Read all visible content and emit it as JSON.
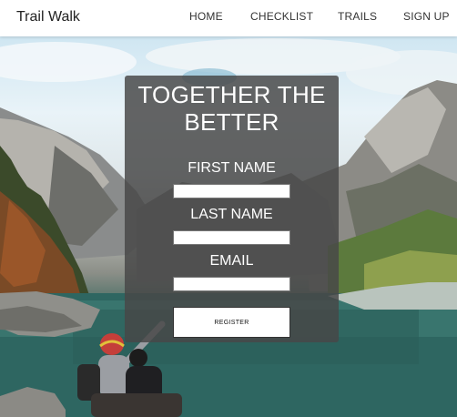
{
  "navbar": {
    "brand": "Trail Walk",
    "links": [
      "HOME",
      "CHECKLIST",
      "TRAILS",
      "SIGN UP"
    ]
  },
  "form": {
    "heading_line1": "TOGETHER THE",
    "heading_line2": "BETTER",
    "first_name_label": "FIRST NAME",
    "first_name_value": "",
    "last_name_label": "LAST NAME",
    "last_name_value": "",
    "email_label": "EMAIL",
    "email_value": "",
    "register_label": "REGISTER"
  },
  "colors": {
    "navbar_bg": "#ffffff",
    "card_bg": "#484848",
    "text_on_card": "#ffffff"
  }
}
